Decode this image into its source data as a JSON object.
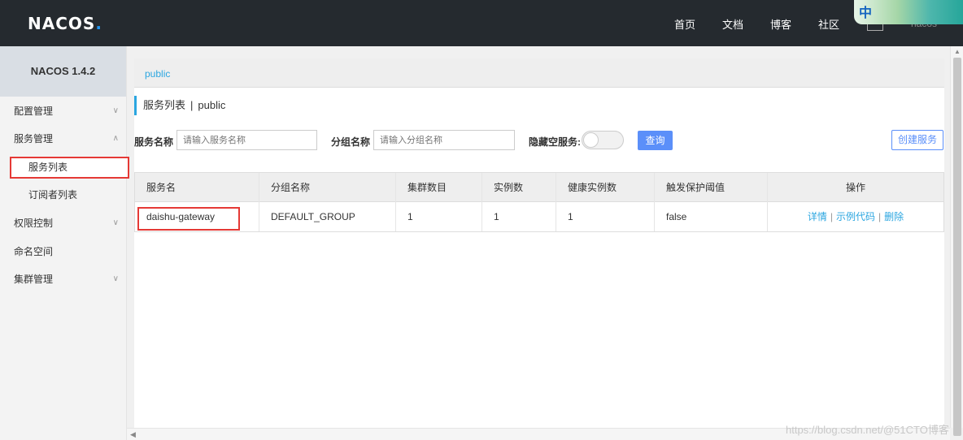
{
  "header": {
    "logo_text": "NACOS",
    "logo_dot": ".",
    "nav": [
      "首页",
      "文档",
      "博客",
      "社区"
    ],
    "deco_text": "中",
    "user": "nacos"
  },
  "sidebar": {
    "version": "NACOS 1.4.2",
    "items": [
      {
        "label": "配置管理",
        "chevron": "down"
      },
      {
        "label": "服务管理",
        "chevron": "up"
      },
      {
        "label": "服务列表",
        "active": true
      },
      {
        "label": "订阅者列表"
      },
      {
        "label": "权限控制",
        "chevron": "down"
      },
      {
        "label": "命名空间"
      },
      {
        "label": "集群管理",
        "chevron": "down"
      }
    ]
  },
  "breadcrumb": "public",
  "page": {
    "title": "服务列表",
    "sep": "|",
    "namespace": "public"
  },
  "filters": {
    "service_name_label": "服务名称",
    "service_name_placeholder": "请输入服务名称",
    "group_name_label": "分组名称",
    "group_name_placeholder": "请输入分组名称",
    "hide_empty_label": "隐藏空服务:",
    "hide_empty_on": false,
    "query_button": "查询",
    "create_button": "创建服务"
  },
  "table": {
    "columns": [
      "服务名",
      "分组名称",
      "集群数目",
      "实例数",
      "健康实例数",
      "触发保护阈值",
      "操作"
    ],
    "rows": [
      {
        "service": "daishu-gateway",
        "group": "DEFAULT_GROUP",
        "clusters": "1",
        "instances": "1",
        "healthy": "1",
        "threshold": "false",
        "ops": [
          "详情",
          "示例代码",
          "删除"
        ]
      }
    ]
  },
  "watermark": "https://blog.csdn.net/@51CTO博客",
  "colors": {
    "header_bg": "#252a2f",
    "accent": "#2ba6e0",
    "primary_button": "#5b8ff9",
    "highlight": "#e53935"
  }
}
